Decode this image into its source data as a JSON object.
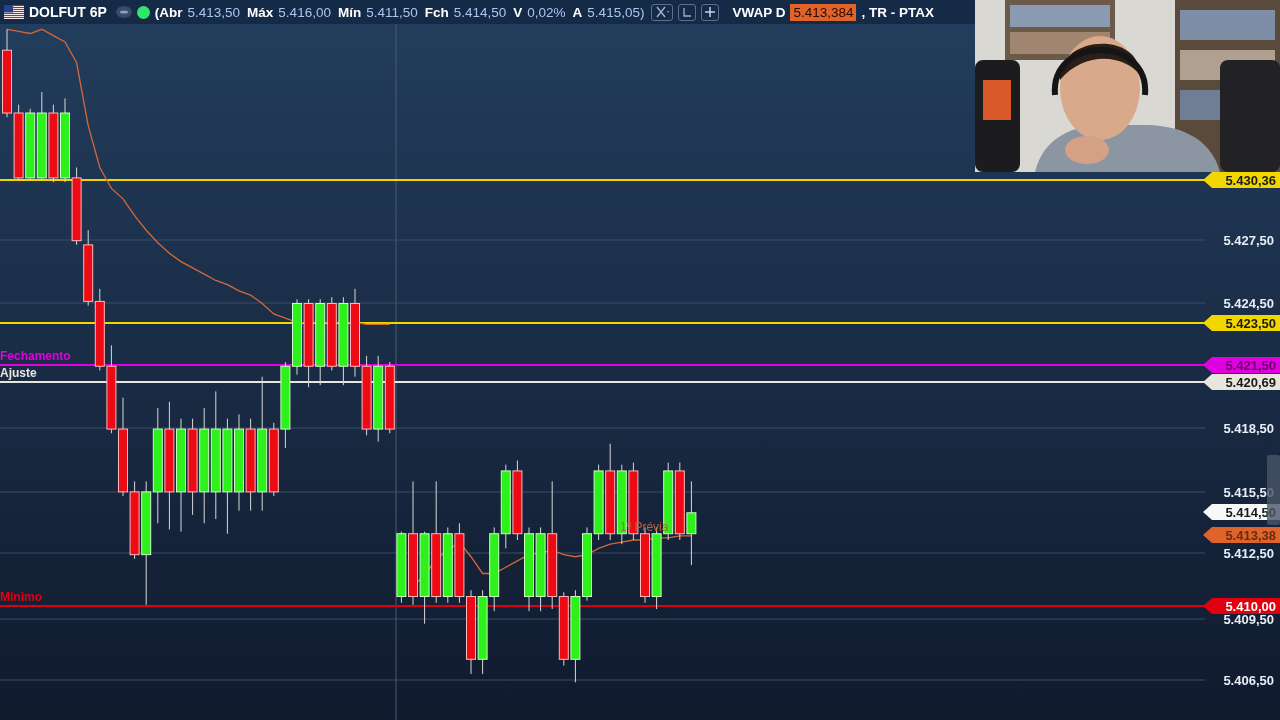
{
  "header": {
    "symbol": "DOLFUT 6P",
    "connected": true,
    "quote": [
      {
        "label": "(Abr",
        "value": "5.413,50"
      },
      {
        "label": "Máx",
        "value": "5.416,00"
      },
      {
        "label": "Mín",
        "value": "5.411,50"
      },
      {
        "label": "Fch",
        "value": "5.414,50"
      },
      {
        "label": "V",
        "value": "0,02%"
      },
      {
        "label": "A",
        "value": "5.415,05)"
      }
    ],
    "vwap": {
      "label": "VWAP D",
      "value": "5.413,384",
      "suffix": ", TR - PTAX"
    }
  },
  "chart": {
    "axis_labels": [
      "5.427,50",
      "5.424,50",
      "5.418,50",
      "5.415,50",
      "5.412,50",
      "5.409,50",
      "5.406,50"
    ],
    "levels": [
      {
        "kind": "line",
        "tag": "5.430,36",
        "color": "#f2d600"
      },
      {
        "kind": "line",
        "tag": "5.423,50",
        "color": "#f2d600"
      },
      {
        "kind": "line",
        "tag": "5.421,50",
        "caption": "Fechamento",
        "color": "#e000e0"
      },
      {
        "kind": "line",
        "tag": "5.420,69",
        "caption": "Ajuste",
        "color": "#e8e6dc"
      },
      {
        "kind": "tag",
        "tag": "5.414,50",
        "color": "#f8f8f8"
      },
      {
        "kind": "tag",
        "tag": "5.413,38",
        "color": "#e0642a"
      },
      {
        "kind": "line",
        "tag": "5.410,00",
        "caption": "Mínimo",
        "color": "#e00010"
      }
    ],
    "note": "1ª Prévia"
  }
}
